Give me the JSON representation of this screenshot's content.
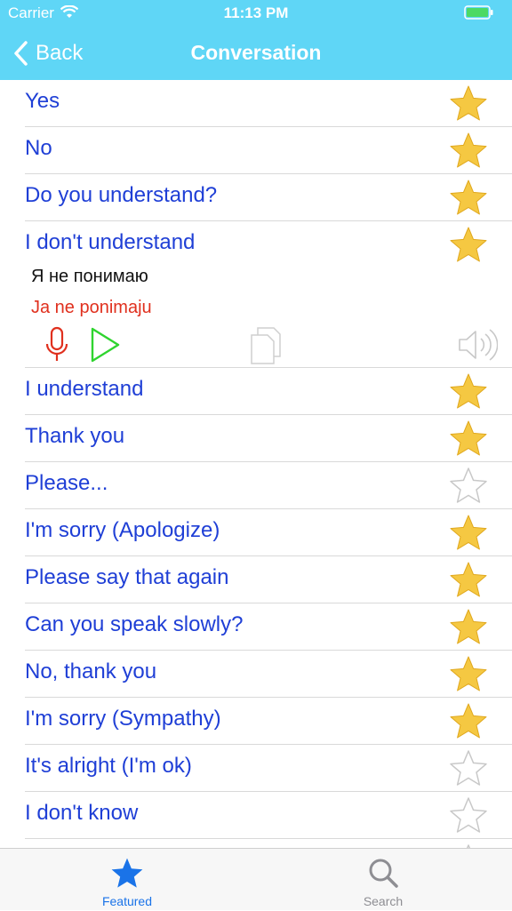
{
  "status_bar": {
    "carrier": "Carrier",
    "time": "11:13 PM"
  },
  "nav": {
    "back_label": "Back",
    "title": "Conversation"
  },
  "colors": {
    "header": "#5fd6f6",
    "phrase": "#1f3fd6",
    "transliteration": "#e0301e",
    "star_fill": "#f5c842",
    "tab_active": "#1a73e8",
    "tab_inactive": "#8e8e93"
  },
  "phrases": [
    {
      "text": "Yes",
      "favorite": true
    },
    {
      "text": "No",
      "favorite": true
    },
    {
      "text": "Do you understand?",
      "favorite": true
    },
    {
      "text": "I don't understand",
      "favorite": true,
      "expanded": true,
      "translation": "Я не понимаю",
      "transliteration": "Ja ne ponimaju"
    },
    {
      "text": "I understand",
      "favorite": true
    },
    {
      "text": "Thank you",
      "favorite": true
    },
    {
      "text": "Please...",
      "favorite": false
    },
    {
      "text": "I'm sorry (Apologize)",
      "favorite": true
    },
    {
      "text": "Please say that again",
      "favorite": true
    },
    {
      "text": "Can you speak slowly?",
      "favorite": true
    },
    {
      "text": "No, thank you",
      "favorite": true
    },
    {
      "text": "I'm sorry (Sympathy)",
      "favorite": true
    },
    {
      "text": "It's alright (I'm ok)",
      "favorite": false
    },
    {
      "text": "I don't know",
      "favorite": false
    },
    {
      "text": "",
      "favorite": false
    }
  ],
  "actions": {
    "icons": [
      "microphone-icon",
      "play-icon",
      "copy-icon",
      "speaker-icon"
    ]
  },
  "tabs": [
    {
      "label": "Featured",
      "icon": "star-icon",
      "active": true
    },
    {
      "label": "Search",
      "icon": "magnifier-icon",
      "active": false
    }
  ]
}
